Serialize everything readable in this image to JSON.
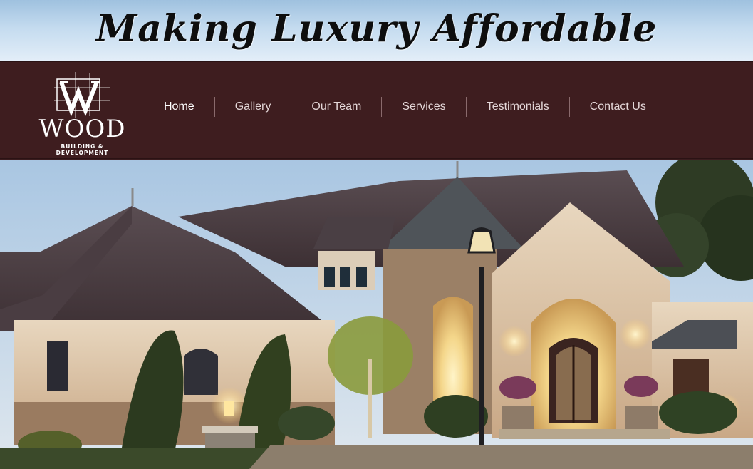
{
  "banner": {
    "tagline": "Making Luxury Affordable"
  },
  "logo": {
    "word": "WOOD",
    "subtitle": "BUILDING & DEVELOPMENT"
  },
  "nav": {
    "items": [
      {
        "label": "Home",
        "active": true
      },
      {
        "label": "Gallery",
        "active": false
      },
      {
        "label": "Our Team",
        "active": false
      },
      {
        "label": "Services",
        "active": false
      },
      {
        "label": "Testimonials",
        "active": false
      },
      {
        "label": "Contact Us",
        "active": false
      }
    ]
  },
  "colors": {
    "nav_background": "#3e1d1f",
    "banner_sky": "#c4dbef",
    "nav_text": "#e4d7d8",
    "nav_active_text": "#ffffff"
  },
  "hero": {
    "icon": "luxury-house-photo"
  }
}
